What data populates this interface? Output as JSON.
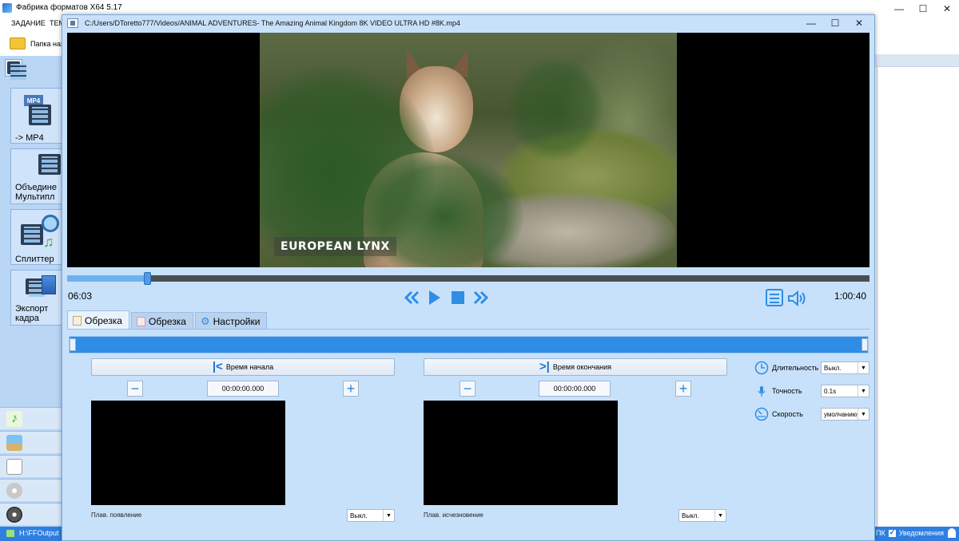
{
  "main_window": {
    "title": "Фабрика форматов X64 5.17",
    "menu": [
      "ЗАДАНИЕ",
      "TEM"
    ],
    "folder_label": "Папка наз",
    "tools": [
      {
        "label": "-> MP4",
        "badge": "MP4"
      },
      {
        "label": "Объедине\nМультипл"
      },
      {
        "label": "Сплиттер"
      },
      {
        "label": "Экспорт\nкадра"
      }
    ],
    "status": {
      "output_path": "H:\\FFOutput",
      "pc_label": "ПК",
      "notifications_label": "Уведомления"
    }
  },
  "player": {
    "title": "C:/Users/DToretto777/Videos/ANIMAL ADVENTURES- The Amazing Animal Kingdom 8K VIDEO ULTRA HD #8K.mp4",
    "video_caption": "EUROPEAN LYNX",
    "time_current": "06:03",
    "time_total": "1:00:40",
    "progress": 0.1,
    "tabs": [
      {
        "label": "Обрезка",
        "active": true
      },
      {
        "label": "Обрезка",
        "active": false
      },
      {
        "label": "Настройки",
        "active": false
      }
    ],
    "start": {
      "button_label": "Время начала",
      "time": "00:00:00.000",
      "fade_label": "Плав. появление",
      "fade_value": "Выкл."
    },
    "end": {
      "button_label": "Время окончания",
      "time": "00:00:00.000",
      "fade_label": "Плав. исчезновение",
      "fade_value": "Выкл."
    },
    "options": [
      {
        "icon": "clock-icon",
        "label": "Длительность",
        "value": "Выкл."
      },
      {
        "icon": "microphone-icon",
        "label": "Точность",
        "value": "0.1s"
      },
      {
        "icon": "speed-gauge-icon",
        "label": "Скорость",
        "value": "умолчанию"
      }
    ]
  },
  "colors": {
    "accent": "#2e8de5",
    "panel": "#c8e1fb",
    "statusbar": "#2f7fe0"
  }
}
